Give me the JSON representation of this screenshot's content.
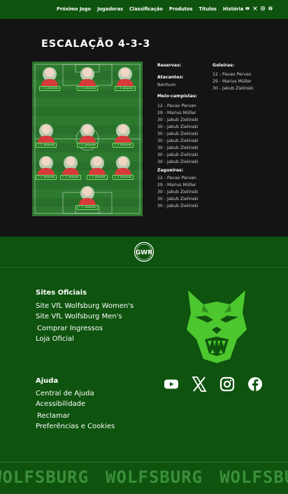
{
  "nav": {
    "links": [
      "Próximo Jogo",
      "Jogadoras",
      "Classificação",
      "Produtos",
      "Títulos",
      "História"
    ],
    "icons": [
      "youtube-icon",
      "x-icon",
      "instagram-icon",
      "facebook-icon"
    ]
  },
  "lineup": {
    "title": "ESCALAÇÃO 4-3-3",
    "players": [
      {
        "number": "1",
        "name": "S. Johannes"
      },
      {
        "number": "1",
        "name": "S. Johannes"
      },
      {
        "number": "1",
        "name": "S. Johannes"
      },
      {
        "number": "1",
        "name": "S. Johannes"
      },
      {
        "number": "1",
        "name": "S. Johannes"
      },
      {
        "number": "1",
        "name": "S. Johannes"
      },
      {
        "number": "1",
        "name": "S. Johannes"
      },
      {
        "number": "1",
        "name": "S. Johannes"
      },
      {
        "number": "1",
        "name": "S. Johannes"
      },
      {
        "number": "1",
        "name": "S. Johannes"
      },
      {
        "number": "1",
        "name": "S. Johannes"
      }
    ]
  },
  "reserves": {
    "title": "Reservas:",
    "attackers_title": "Atacantes:",
    "attackers": [
      "Nenhum"
    ],
    "midfielders_title": "Meio-campistas:",
    "midfielders": [
      "12 - Pavao Pervan",
      "29 - Marius Müller",
      "30 - Jakub Zielinski",
      "30 - Jakub Zielinski",
      "30 - Jakub Zielinski",
      "30 - Jakub Zielinski",
      "30 - Jakub Zielinski",
      "30 - Jakub Zielinski",
      "30 - Jakub Zielinski"
    ],
    "defenders_title": "Zagueiras:",
    "defenders": [
      "12 - Pavao Pervan",
      "29 - Marius Müller",
      "30 - Jakub Zielinski",
      "30 - Jakub Zielinski",
      "30 - Jakub Zielinski"
    ],
    "goalkeepers_title": "Goleiras:",
    "goalkeepers": [
      "12 - Pavao Pervan",
      "29 - Marius Müller",
      "30 - Jakub Zielinski"
    ]
  },
  "footer": {
    "logo_text": "GWR",
    "sites_title": "Sites Oficiais",
    "sites_links": [
      "Site VfL Wolfsburg Women's",
      "Site VfL Wolfsburg Men's",
      "Comprar Ingressos",
      "Loja Oficial"
    ],
    "help_title": "Ajuda",
    "help_links": [
      "Central de Ajuda",
      "Acessibilidade",
      "Reclamar",
      "Preferências e Cookies"
    ],
    "social": [
      "youtube-icon",
      "x-icon",
      "instagram-icon",
      "facebook-icon"
    ],
    "marquee": [
      "WOLFSBURG",
      "WOLFSBURG",
      "WOLFSBURG"
    ]
  },
  "colors": {
    "background": "#141414",
    "brand_green": "#0e530e",
    "pitch_green": "#2d7a2f",
    "wolf_green": "#4cc72e",
    "marquee_green": "#3a8f3a"
  }
}
